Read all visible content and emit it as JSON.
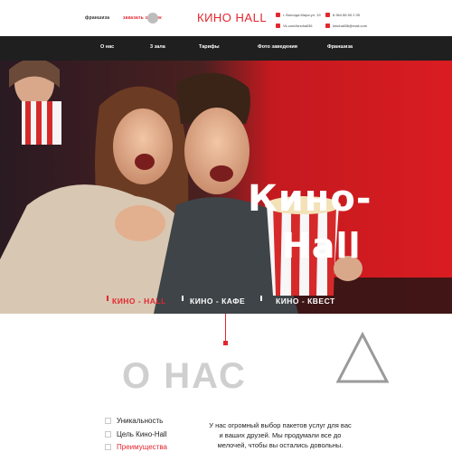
{
  "header": {
    "franchise_link": "франшиза",
    "order_link": "заказать звонок",
    "logo": "КИНО HALL",
    "address": "г. Вологда Мира ул. 19",
    "phone": "8 964 86 55 2 05",
    "vk": "Vk.com/kinohall36",
    "email": "kinohall36@mail.com"
  },
  "nav": {
    "items": [
      "О нас",
      "3 зала",
      "Тарифы",
      "Фото заведения",
      "Франшиза"
    ]
  },
  "hero": {
    "title_line1": "Кино-",
    "title_line2": "Hall",
    "sub_nav": [
      "КИНО - HALL",
      "КИНО - КАФЕ",
      "КИНО - КВЕСТ"
    ]
  },
  "about": {
    "title": "О НАС",
    "list": [
      "Уникальность",
      "Цель Кино-Hall",
      "Преимущества"
    ],
    "text": "У нас огромный выбор пакетов услуг для вас и ваших друзей. Мы продумали все до мелочей, чтобы вы остались довольны."
  },
  "colors": {
    "accent": "#e3262f",
    "nav_bg": "#1f1f1f",
    "about_title": "#cfcfcf"
  }
}
